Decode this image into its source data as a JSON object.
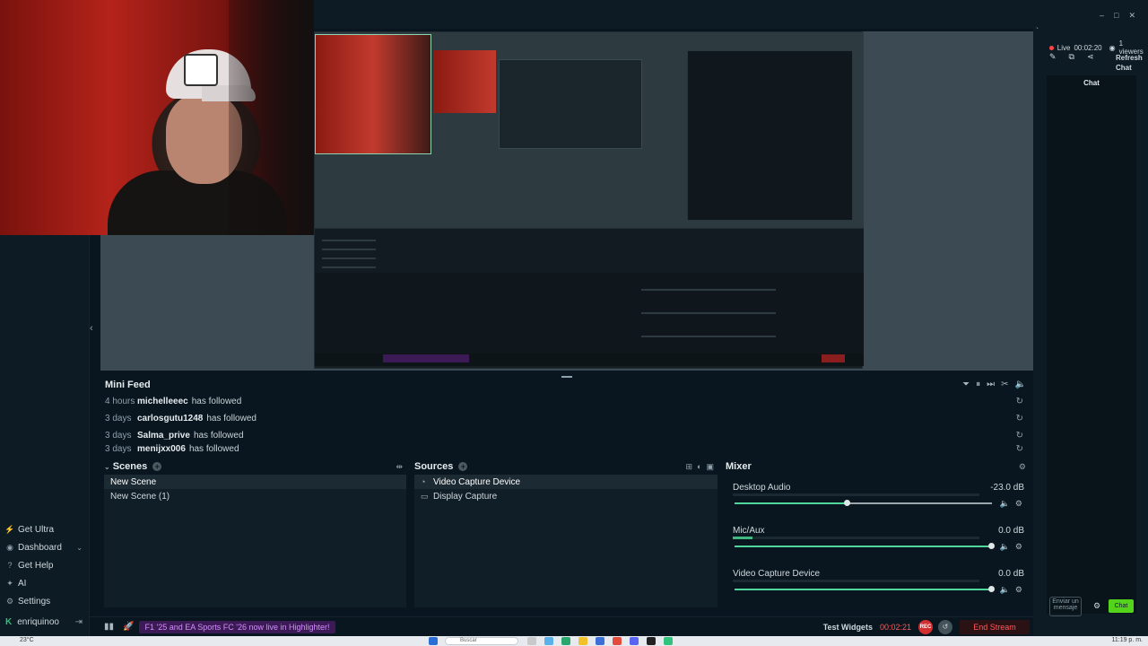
{
  "window": {
    "controls": [
      "–",
      "□",
      "✕"
    ]
  },
  "sidebar": {
    "items": [
      {
        "icon": "lightning-icon",
        "label": "Get Ultra",
        "glyph": "⚡"
      },
      {
        "icon": "dashboard-icon",
        "label": "Dashboard",
        "glyph": "◉",
        "chevron": "⌄"
      },
      {
        "icon": "help-icon",
        "label": "Get Help",
        "glyph": "?"
      },
      {
        "icon": "ai-icon",
        "label": "AI",
        "glyph": "✦"
      },
      {
        "icon": "settings-icon",
        "label": "Settings",
        "glyph": "⚙"
      }
    ],
    "user": {
      "name": "enriquinoo",
      "glyph": "K",
      "logout": "⇥"
    }
  },
  "mini_feed": {
    "title": "Mini Feed",
    "tools": [
      "⏷",
      "⏸",
      "⏭",
      "✂",
      "🔈"
    ],
    "events": [
      {
        "time": "4 hours",
        "user": "michelleeec",
        "action": "has followed"
      },
      {
        "time": "3 days",
        "user": "carlosgutu1248",
        "action": "has followed"
      },
      {
        "time": "3 days",
        "user": "Salma_prive",
        "action": "has followed"
      },
      {
        "time": "3 days",
        "user": "menijxx006",
        "action": "has followed"
      }
    ],
    "replay_glyph": "↻"
  },
  "scenes": {
    "title": "Scenes",
    "add": "+",
    "items": [
      "New Scene",
      "New Scene (1)"
    ],
    "selected": 0
  },
  "sources": {
    "title": "Sources",
    "add": "+",
    "items": [
      {
        "label": "Video Capture Device",
        "glyph": "◔"
      },
      {
        "label": "Display Capture",
        "glyph": "▭"
      }
    ],
    "selected": 0
  },
  "mixer": {
    "title": "Mixer",
    "settings_glyph": "⚙",
    "channels": [
      {
        "name": "Desktop Audio",
        "db": "-23.0 dB",
        "volume": 0.44,
        "meter": 0.0
      },
      {
        "name": "Mic/Aux",
        "db": "0.0 dB",
        "volume": 1.0,
        "meter": 0.08
      },
      {
        "name": "Video Capture Device",
        "db": "0.0 dB",
        "volume": 1.0,
        "meter": 0.0
      }
    ]
  },
  "footer": {
    "stats_glyph": "▮▮",
    "rocket_glyph": "🚀",
    "promo": "F1 '25 and EA Sports FC '26 now live in Highlighter!",
    "test_widgets": "Test Widgets",
    "timer": "00:02:21",
    "rec": "REC",
    "replay_glyph": "↺",
    "end_stream": "End Stream"
  },
  "chat_panel": {
    "live_label": "Live",
    "live_time": "00:02:20",
    "viewers": "1 viewers",
    "refresh": "Refresh Chat",
    "chat_header": "Chat",
    "compose_placeholder": "Enviar un mensaje",
    "send": "Chat",
    "colors": {
      "live_dot": "#ff4444",
      "send_button": "#53d41a"
    }
  },
  "taskbar": {
    "weather": "23°C",
    "search_placeholder": "Buscar",
    "clock": "11:19 p. m."
  },
  "colors": {
    "accent_green": "#31c27c",
    "end_stream_red": "#ff5a5a",
    "promo_purple": "#d48cff"
  }
}
